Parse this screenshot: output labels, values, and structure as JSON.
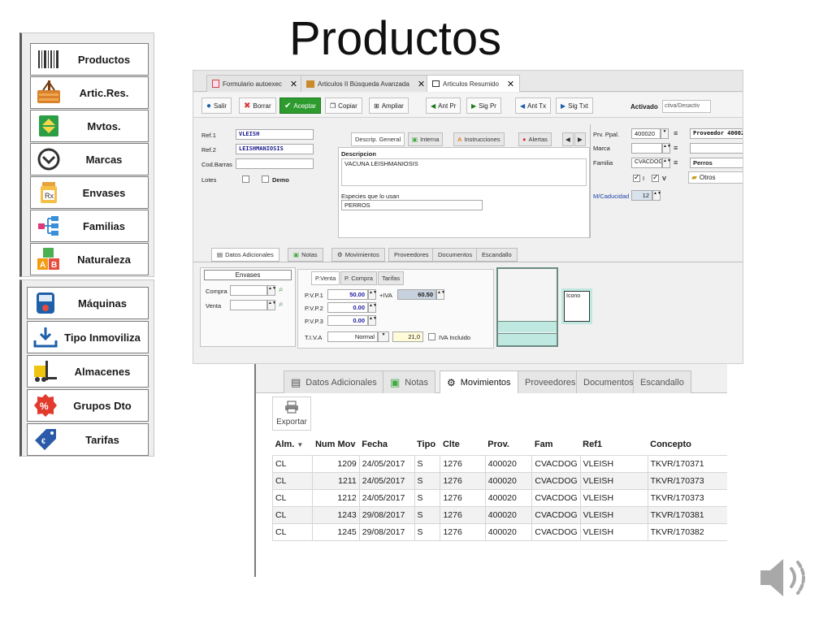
{
  "slide": {
    "title": "Productos"
  },
  "menu_top": [
    {
      "label": "Productos",
      "icon": "barcode-icon"
    },
    {
      "label": "Artic.Res.",
      "icon": "basket-icon"
    },
    {
      "label": "Mvtos.",
      "icon": "up-down-arrows-icon"
    },
    {
      "label": "Marcas",
      "icon": "brand-logo-icon"
    },
    {
      "label": "Envases",
      "icon": "pill-bottle-icon"
    },
    {
      "label": "Familias",
      "icon": "tree-icon"
    },
    {
      "label": "Naturaleza",
      "icon": "blocks-icon"
    }
  ],
  "menu_bottom": [
    {
      "label": "Máquinas",
      "icon": "machine-icon"
    },
    {
      "label": "Tipo Inmoviliza",
      "icon": "download-tray-icon"
    },
    {
      "label": "Almacenes",
      "icon": "forklift-icon"
    },
    {
      "label": "Grupos Dto",
      "icon": "percent-badge-icon"
    },
    {
      "label": "Tarifas",
      "icon": "price-tag-icon"
    }
  ],
  "window": {
    "tabs": [
      "Formulario autoexec",
      "Articulos II Búsqueda Avanzada",
      "Articulos Resumido"
    ],
    "toolbar": {
      "salir": "Salir",
      "borrar": "Borrar",
      "aceptar": "Aceptar",
      "copiar": "Copiar",
      "ampliar": "Ampliar",
      "ant_pr": "Ant Pr",
      "sig_pr": "Sig Pr",
      "ant_tx": "Ant Tx",
      "sig_txt": "Sig Txt",
      "activado_label": "Activado",
      "activado_value": "ctiva/Desactiv"
    },
    "form": {
      "ref1_label": "Ref.1",
      "ref1_value": "VLEISH",
      "ref2_label": "Ref.2",
      "ref2_value": "LEISHMANIOSIS",
      "cod_barras_label": "Cod.Barras",
      "lotes_label": "Lotes",
      "demo_label": "Demo"
    },
    "mid_tabs": [
      "Descrip. General",
      "Interna",
      "Instrucciones",
      "Alertas"
    ],
    "descripcion_label": "Descripcion",
    "descripcion_value": "VACUNA LEISHMANIOSIS",
    "especies_label": "Especies que lo usan",
    "especies_value": "PERROS",
    "right": {
      "prv_ppal_label": "Prv. Ppal.",
      "prv_ppal_value": "400020",
      "proveedor_value": "Proveedor 40002",
      "marca_label": "Marca",
      "familia_label": "Familia",
      "familia_code": "CVACDOG",
      "familia_value": "Perros",
      "i_label": "I",
      "v_label": "V",
      "otros_label": "Otros",
      "caducidad_label": "M/Caducidad",
      "caducidad_value": "12"
    },
    "lower_tabs": [
      "Datos Adicionales",
      "Notas",
      "Movimientos",
      "Proveedores",
      "Documentos",
      "Escandallo"
    ],
    "envases": {
      "header": "Envases",
      "compra_label": "Compra",
      "venta_label": "Venta"
    },
    "price_tabs": [
      "P.Venta",
      "P. Compra",
      "Tarifas"
    ],
    "prices": {
      "pvp1_label": "P.V.P.1",
      "pvp1_value": "50.00",
      "iva_prefix": "+IVA",
      "iva_value": "60.50",
      "pvp2_label": "P.V.P.2",
      "pvp2_value": "0.00",
      "pvp3_label": "P.V.P.3",
      "pvp3_value": "0.00",
      "tiva_label": "T.I.V.A",
      "tiva_value": "Normal",
      "tiva_rate": "21,0",
      "iva_incluido_label": "IVA Incluido"
    },
    "icono_label": "Icono"
  },
  "movements": {
    "tabs": [
      "Datos Adicionales",
      "Notas",
      "Movimientos",
      "Proveedores",
      "Documentos",
      "Escandallo"
    ],
    "export_label": "Exportar",
    "columns": [
      "Alm.",
      "Num Mov",
      "Fecha",
      "Tipo",
      "Clte",
      "Prov.",
      "Fam",
      "Ref1",
      "Concepto"
    ],
    "rows": [
      [
        "CL",
        "1209",
        "24/05/2017",
        "S",
        "1276",
        "400020",
        "CVACDOG",
        "VLEISH",
        "TKVR/170371"
      ],
      [
        "CL",
        "1211",
        "24/05/2017",
        "S",
        "1276",
        "400020",
        "CVACDOG",
        "VLEISH",
        "TKVR/170373"
      ],
      [
        "CL",
        "1212",
        "24/05/2017",
        "S",
        "1276",
        "400020",
        "CVACDOG",
        "VLEISH",
        "TKVR/170373"
      ],
      [
        "CL",
        "1243",
        "29/08/2017",
        "S",
        "1276",
        "400020",
        "CVACDOG",
        "VLEISH",
        "TKVR/170381"
      ],
      [
        "CL",
        "1245",
        "29/08/2017",
        "S",
        "1276",
        "400020",
        "CVACDOG",
        "VLEISH",
        "TKVR/170382"
      ]
    ]
  }
}
